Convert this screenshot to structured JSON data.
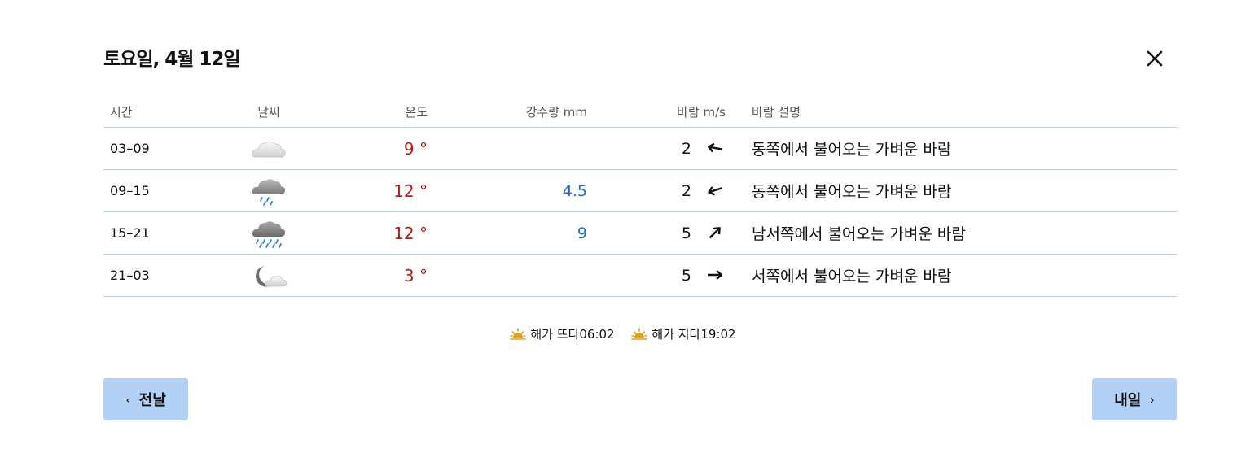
{
  "dialog": {
    "title": "토요일, 4월 12일",
    "close_label": "close"
  },
  "table": {
    "headers": {
      "time": "시간",
      "weather": "날씨",
      "temperature": "온도",
      "precipitation": "강수량 mm",
      "wind": "바람 m/s",
      "wind_desc": "바람 설명"
    },
    "rows": [
      {
        "time": "03–09",
        "icon": "cloudy-icon",
        "temp": "9 °",
        "precip": "",
        "wind": "2",
        "wind_dir": "east",
        "desc": "동쪽에서 불어오는 가벼운 바람"
      },
      {
        "time": "09–15",
        "icon": "light-rain-icon",
        "temp": "12 °",
        "precip": "4.5",
        "wind": "2",
        "wind_dir": "east-northeast",
        "desc": "동쪽에서 불어오는 가벼운 바람"
      },
      {
        "time": "15–21",
        "icon": "rain-icon",
        "temp": "12 °",
        "precip": "9",
        "wind": "5",
        "wind_dir": "southwest",
        "desc": "남서쪽에서 불어오는 가벼운 바람"
      },
      {
        "time": "21–03",
        "icon": "partly-cloudy-night-icon",
        "temp": "3 °",
        "precip": "",
        "wind": "5",
        "wind_dir": "west",
        "desc": "서쪽에서 불어오는 가벼운 바람"
      }
    ]
  },
  "sun": {
    "sunrise_label": "해가 뜨다",
    "sunrise_time": "06:02",
    "sunset_label": "해가 지다",
    "sunset_time": "19:02"
  },
  "nav": {
    "prev_label": "전날",
    "next_label": "내일"
  },
  "colors": {
    "temperature": "#b01c12",
    "precipitation": "#1f6fbf",
    "button": "#b3d1f6",
    "divider": "#b8cfe0",
    "sun_icon": "#e0a020"
  }
}
